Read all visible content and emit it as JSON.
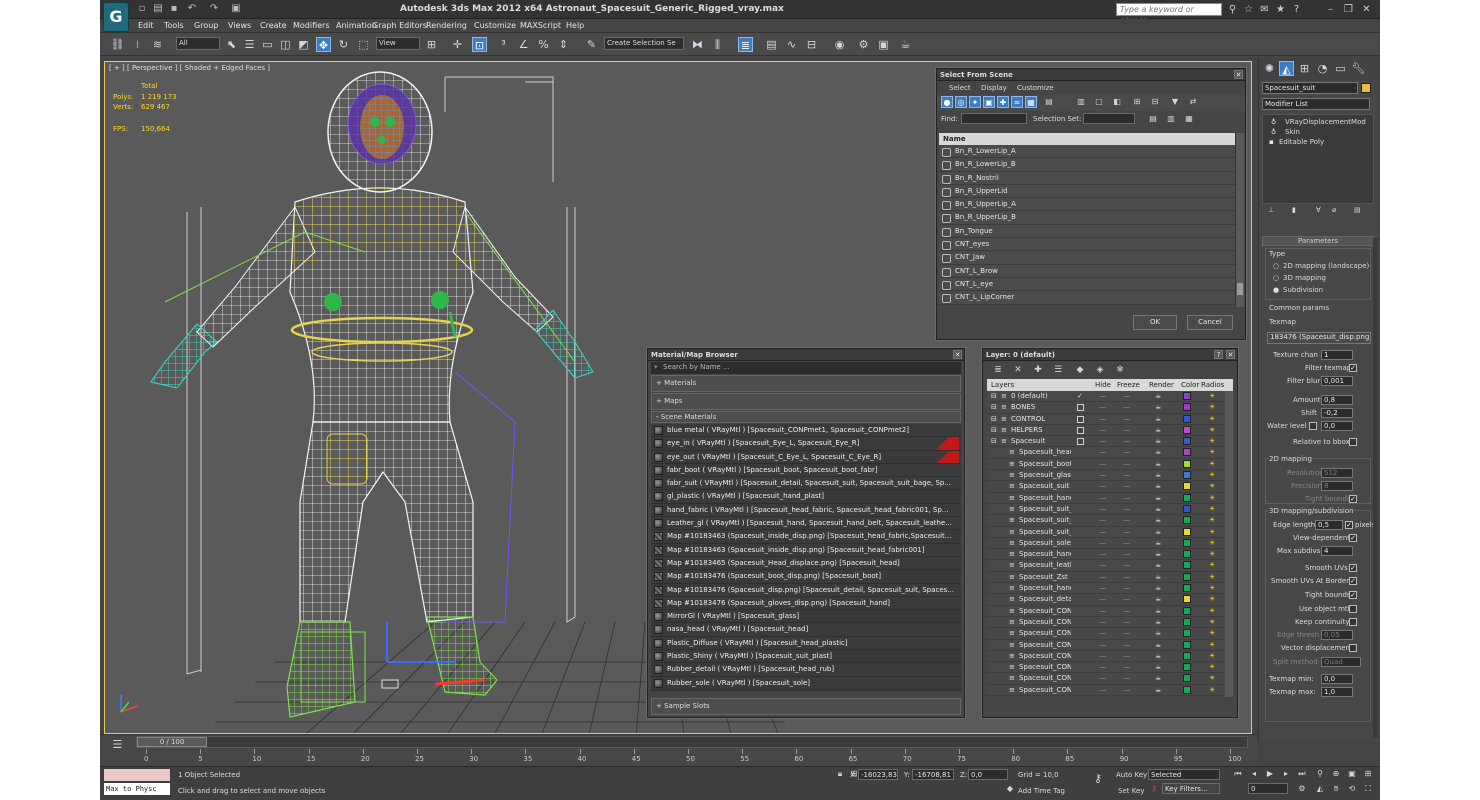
{
  "titlebar": {
    "title": "Autodesk 3ds Max  2012 x64     Astronaut_Spacesuit_Generic_Rigged_vray.max",
    "search_placeholder": "Type a keyword or phrase"
  },
  "menubar": [
    "Edit",
    "Tools",
    "Group",
    "Views",
    "Create",
    "Modifiers",
    "Animation",
    "Graph Editors",
    "Rendering",
    "Customize",
    "MAXScript",
    "Help"
  ],
  "toolbar": {
    "filter": "All",
    "ref_coord": "View",
    "named_selection": "Create Selection Se"
  },
  "viewport": {
    "label": "[ + ] [ Perspective ] [ Shaded + Edged Faces ]",
    "stats": {
      "total": "Total",
      "polys_label": "Polys:",
      "polys": "1 219 173",
      "verts_label": "Verts:",
      "verts": "629 467",
      "fps_label": "FPS:",
      "fps": "150,664"
    }
  },
  "select_from_scene": {
    "title": "Select From Scene",
    "menus": [
      "Select",
      "Display",
      "Customize"
    ],
    "find_label": "Find:",
    "selset_label": "Selection Set:",
    "column": "Name",
    "rows": [
      "Bn_R_LowerLip_A",
      "Bn_R_LowerLip_B",
      "Bn_R_Nostril",
      "Bn_R_UpperLid",
      "Bn_R_UpperLip_A",
      "Bn_R_UpperLip_B",
      "Bn_Tongue",
      "CNT_eyes",
      "CNT_Jaw",
      "CNT_L_Brow",
      "CNT_L_eye",
      "CNT_L_LipCorner"
    ],
    "ok": "OK",
    "cancel": "Cancel"
  },
  "material_browser": {
    "title": "Material/Map Browser",
    "search_placeholder": "Search by Name ...",
    "sections": {
      "materials": "+ Materials",
      "maps": "+ Maps",
      "scene": "- Scene Materials",
      "samples": "+ Sample Slots"
    },
    "items": [
      {
        "t": "blue metal  ( VRayMtl ) [Spacesuit_CONPmet1, Spacesuit_CONPmet2]",
        "k": "mat"
      },
      {
        "t": "eye_in  ( VRayMtl ) [Spacesuit_Eye_L, Spacesuit_Eye_R]",
        "k": "mat",
        "flag": true
      },
      {
        "t": "eye_out  ( VRayMtl ) [Spacesuit_C_Eye_L, Spacesuit_C_Eye_R]",
        "k": "mat",
        "flag": true
      },
      {
        "t": "fabr_boot ( VRayMtl ) [Spacesuit_boot, Spacesuit_boot_fabr]",
        "k": "mat"
      },
      {
        "t": "fabr_suit ( VRayMtl ) [Spacesuit_detail, Spacesuit_suit, Spacesuit_suit_bage, Sp...",
        "k": "mat"
      },
      {
        "t": "gl_plastic ( VRayMtl ) [Spacesuit_hand_plast]",
        "k": "mat"
      },
      {
        "t": "hand_fabric ( VRayMtl ) [Spacesuit_head_fabric, Spacesuit_head_fabric001, Sp...",
        "k": "mat"
      },
      {
        "t": "Leather_gl ( VRayMtl ) [Spacesuit_hand, Spacesuit_hand_belt, Spacesuit_leathe...",
        "k": "mat"
      },
      {
        "t": "Map #10183463 (Spacesuit_inside_disp.png) [Spacesuit_head_fabric,Spacesuit...",
        "k": "map"
      },
      {
        "t": "Map #10183463 (Spacesuit_inside_disp.png) [Spacesuit_head_fabric001]",
        "k": "map"
      },
      {
        "t": "Map #10183465 (Spacesuit_Head_displace.png) [Spacesuit_head]",
        "k": "map"
      },
      {
        "t": "Map #10183476 (Spacesuit_boot_disp.png) [Spacesuit_boot]",
        "k": "map"
      },
      {
        "t": "Map #10183476 (Spacesuit_disp.png) [Spacesuit_detail, Spacesuit_suit, Spaces...",
        "k": "map"
      },
      {
        "t": "Map #10183476 (Spacesuit_gloves_disp.png) [Spacesuit_hand]",
        "k": "map"
      },
      {
        "t": "MirrorGl  ( VRayMtl ) [Spacesuit_glass]",
        "k": "mat"
      },
      {
        "t": "nasa_head  ( VRayMtl ) [Spacesuit_head]",
        "k": "mat"
      },
      {
        "t": "Plastic_Diffuse  ( VRayMtl ) [Spacesuit_head_plastic]",
        "k": "mat"
      },
      {
        "t": "Plastic_Shiny  ( VRayMtl ) [Spacesuit_suit_plast]",
        "k": "mat"
      },
      {
        "t": "Rubber_detail  ( VRayMtl ) [Spacesuit_head_rub]",
        "k": "mat"
      },
      {
        "t": "Rubber_sole  ( VRayMtl ) [Spacesuit_sole]",
        "k": "mat"
      }
    ]
  },
  "layer_manager": {
    "title": "Layer: 0 (default)",
    "columns": [
      "Layers",
      "Hide",
      "Freeze",
      "Render",
      "Color",
      "Radios"
    ],
    "layers": [
      {
        "n": "0 (default)",
        "lvl": 0,
        "c": "#8844cc",
        "check": "✓"
      },
      {
        "n": "BONES",
        "lvl": 0,
        "c": "#aa33cc"
      },
      {
        "n": "CONTROL",
        "lvl": 0,
        "c": "#3355dd"
      },
      {
        "n": "HELPERS",
        "lvl": 0,
        "c": "#cc44cc"
      },
      {
        "n": "Spacesuit",
        "lvl": 0,
        "c": "#4455cc"
      },
      {
        "n": "Spacesuit_head_",
        "lvl": 1,
        "c": "#aa44cc"
      },
      {
        "n": "Spacesuit_boot",
        "lvl": 1,
        "c": "#99dd33"
      },
      {
        "n": "Spacesuit_glass",
        "lvl": 1,
        "c": "#4477dd"
      },
      {
        "n": "Spacesuit_suit",
        "lvl": 1,
        "c": "#dddd33"
      },
      {
        "n": "Spacesuit_hand",
        "lvl": 1,
        "c": "#11aa55"
      },
      {
        "n": "Spacesuit_suit_r",
        "lvl": 1,
        "c": "#3355cc"
      },
      {
        "n": "Spacesuit_suit_z",
        "lvl": 1,
        "c": "#11aa55"
      },
      {
        "n": "Spacesuit_suit_b",
        "lvl": 1,
        "c": "#dddd33"
      },
      {
        "n": "Spacesuit_sole",
        "lvl": 1,
        "c": "#11aa55"
      },
      {
        "n": "Spacesuit_hand_",
        "lvl": 1,
        "c": "#11aa55"
      },
      {
        "n": "Spacesuit_leathe",
        "lvl": 1,
        "c": "#11aa55"
      },
      {
        "n": "Spacesuit_Zst",
        "lvl": 1,
        "c": "#11aa55"
      },
      {
        "n": "Spacesuit_hand_",
        "lvl": 1,
        "c": "#11aa55"
      },
      {
        "n": "Spacesuit_detail",
        "lvl": 1,
        "c": "#dddd33"
      },
      {
        "n": "Spacesuit_CONP",
        "lvl": 1,
        "c": "#11aa55"
      },
      {
        "n": "Spacesuit_CONs",
        "lvl": 1,
        "c": "#11aa55"
      },
      {
        "n": "Spacesuit_CONP",
        "lvl": 1,
        "c": "#11aa55"
      },
      {
        "n": "Spacesuit_CONn",
        "lvl": 1,
        "c": "#11aa55"
      },
      {
        "n": "Spacesuit_CONs",
        "lvl": 1,
        "c": "#11aa55"
      },
      {
        "n": "Spacesuit_CONP",
        "lvl": 1,
        "c": "#11aa55"
      },
      {
        "n": "Spacesuit_CONs",
        "lvl": 1,
        "c": "#11aa55"
      },
      {
        "n": "Spacesuit_CONs",
        "lvl": 1,
        "c": "#11aa55"
      }
    ]
  },
  "command_panel": {
    "object_name": "Spacesuit_suit",
    "modifier_list": "Modifier List",
    "stack": [
      "VRayDisplacementMod",
      "Skin",
      "Editable Poly"
    ],
    "parameters": "Parameters",
    "type_label": "Type",
    "types": [
      "2D mapping (landscape)",
      "3D mapping",
      "Subdivision"
    ],
    "common": "Common params",
    "texmap_label": "Texmap",
    "texmap": "183476 (Spacesuit_disp.png)",
    "texture_chan_label": "Texture chan",
    "texture_chan": "1",
    "filter_texmap": "Filter texmap",
    "filter_blur_label": "Filter blur",
    "filter_blur": "0,001",
    "amount_label": "Amount",
    "amount": "0,8",
    "shift_label": "Shift",
    "shift": "-0,2",
    "water_label": "Water level",
    "water": "0,0",
    "relative_bbox": "Relative to bbox",
    "map2d": "2D mapping",
    "resolution_label": "Resolution",
    "resolution": "512",
    "precision_label": "Precision",
    "precision": "8",
    "tight_bounds": "Tight bounds",
    "subdiv": "3D mapping/subdivision",
    "edge_length_label": "Edge length",
    "edge_length": "0,5",
    "pixels": "pixels",
    "view_dependent": "View-dependent",
    "max_subdivs_label": "Max subdivs",
    "max_subdivs": "4",
    "smooth_uvs": "Smooth UVs",
    "smooth_uvs_borders": "Smooth UVs At Borders",
    "tight_bounds2": "Tight bounds",
    "use_object_mtl": "Use object mtl",
    "keep_continuity": "Keep continuity",
    "edge_thresh_label": "Edge thresh",
    "edge_thresh": "0,05",
    "vector_displacement": "Vector displacement",
    "split_method_label": "Split method",
    "split_method": "Quad",
    "texmap_min_label": "Texmap min:",
    "texmap_min": "0,0",
    "texmap_max_label": "Texmap max:",
    "texmap_max": "1,0"
  },
  "timeline": {
    "frame": "0 / 100",
    "ticks": [
      "0",
      "5",
      "10",
      "15",
      "20",
      "25",
      "30",
      "35",
      "40",
      "45",
      "50",
      "55",
      "60",
      "65",
      "70",
      "75",
      "80",
      "85",
      "90",
      "95",
      "100"
    ],
    "current": 0,
    "max": 100
  },
  "status": {
    "maxscript": "Max to Physc",
    "selected": "1 Object Selected",
    "prompt": "Click and drag to select and move objects",
    "x_label": "X:",
    "x": "-16023,83",
    "y_label": "Y:",
    "y": "-16708,81",
    "z_label": "Z:",
    "z": "0,0",
    "grid": "Grid = 10,0",
    "add_time_tag": "Add Time Tag",
    "autokey": "Auto Key",
    "setkey": "Set Key",
    "selected_dd": "Selected",
    "key_filters": "Key Filters...",
    "frame_field": "0"
  },
  "colors": {
    "accent": "#3b7cc3",
    "viewport_border": "#f0c84a",
    "stats": "#ffd72a",
    "wire_white": "#ffffff",
    "wire_yellow": "#e8d24a",
    "wire_cyan": "#3fd6c8",
    "wire_green": "#7fe04a"
  }
}
